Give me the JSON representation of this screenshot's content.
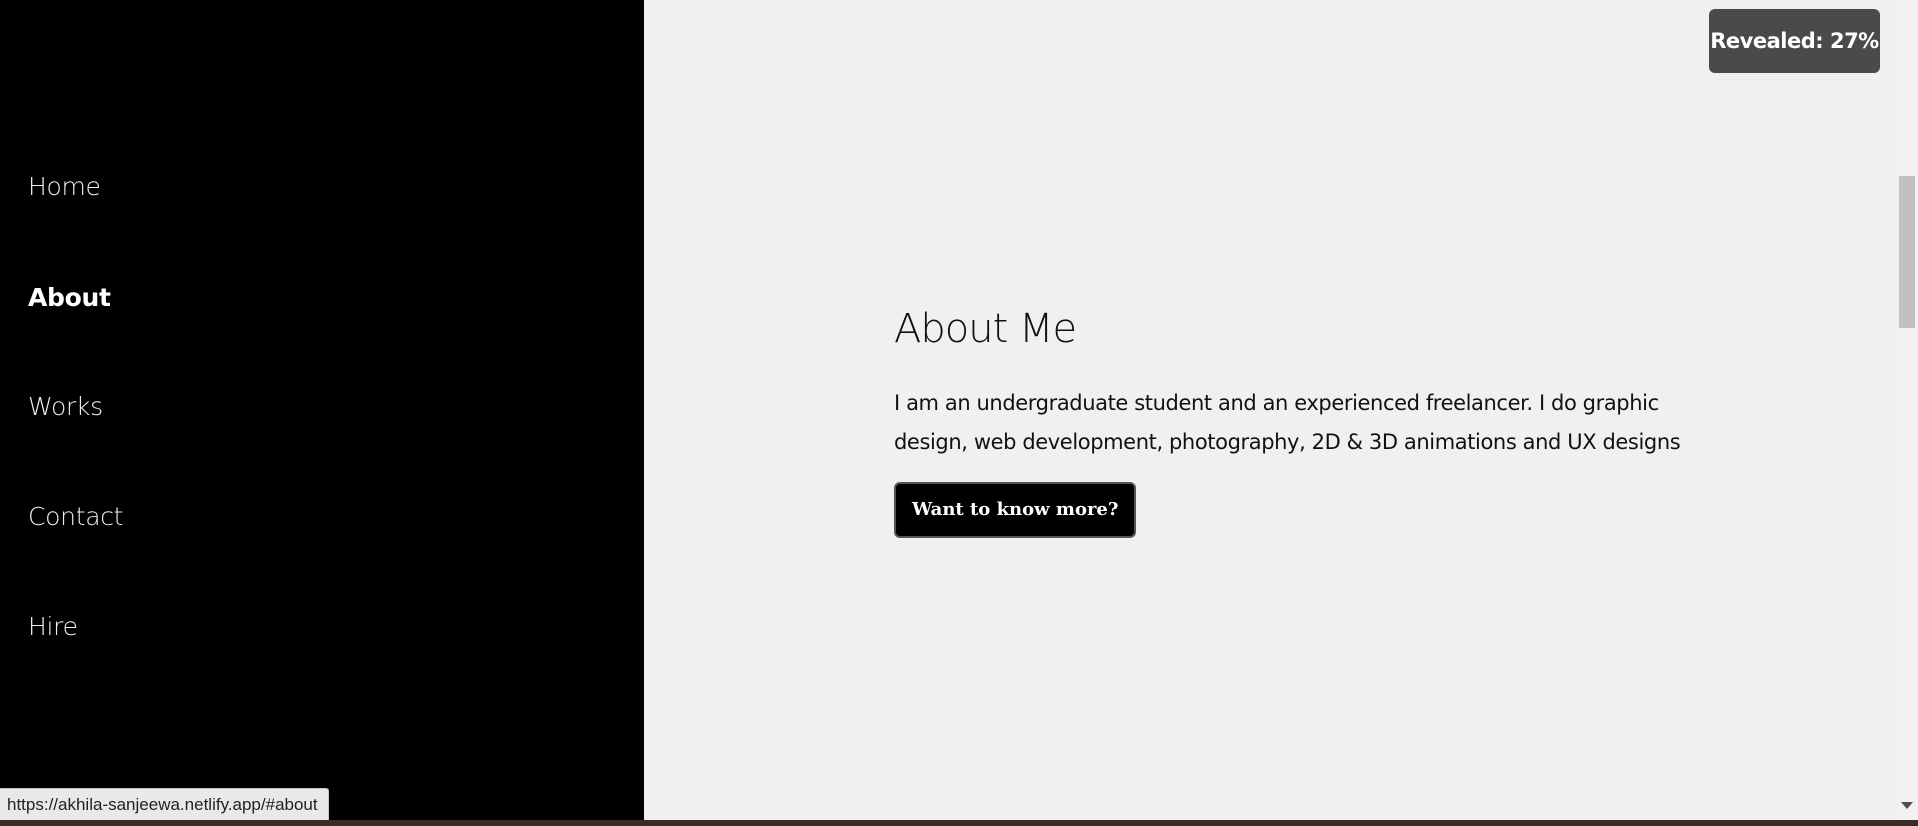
{
  "nav": {
    "items": [
      {
        "label": "Home",
        "active": false
      },
      {
        "label": "About",
        "active": true
      },
      {
        "label": "Works",
        "active": false
      },
      {
        "label": "Contact",
        "active": false
      },
      {
        "label": "Hire",
        "active": false
      }
    ]
  },
  "about": {
    "heading": "About Me",
    "paragraph": "I am an undergraduate student and an experienced freelancer. I do graphic design, web development, photography, 2D & 3D animations and UX designs",
    "cta_label": "Want to know more?"
  },
  "reveal": {
    "label": "Revealed: 27%",
    "percent": 27
  },
  "status_bar": {
    "url": "https://akhila-sanjeewa.netlify.app/#about"
  },
  "colors": {
    "sidebar_bg": "#000000",
    "main_bg": "#f0f0f0",
    "badge_bg": "#4a4a4a",
    "button_bg": "#000000"
  }
}
